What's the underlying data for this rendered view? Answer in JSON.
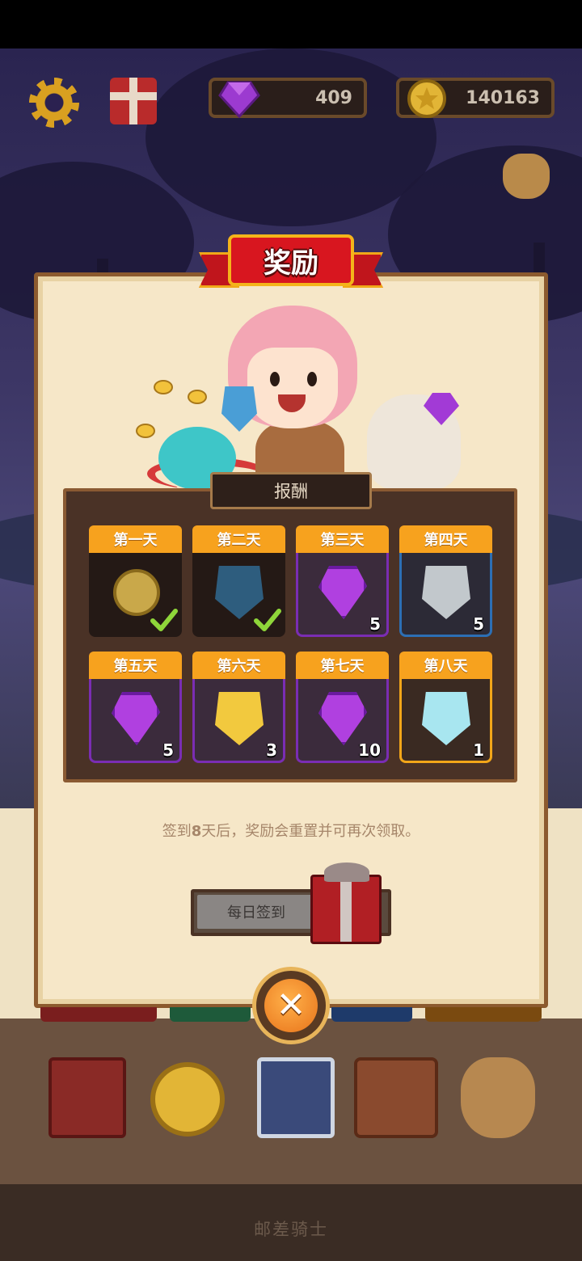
{
  "hud": {
    "gems": "409",
    "coins": "140163",
    "icons": [
      "settings-gear-icon",
      "gift-icon",
      "gem-icon",
      "coin-icon",
      "loot-bag-icon"
    ]
  },
  "dialog": {
    "title": "奖励",
    "board_title": "报酬",
    "rewards": [
      {
        "day": "第一天",
        "item": "coin",
        "quantity": "",
        "claimed": true
      },
      {
        "day": "第二天",
        "item": "dark-blue-shield",
        "quantity": "",
        "claimed": true
      },
      {
        "day": "第三天",
        "item": "purple-gem",
        "quantity": "5",
        "claimed": false
      },
      {
        "day": "第四天",
        "item": "silver-shield",
        "quantity": "5",
        "claimed": false
      },
      {
        "day": "第五天",
        "item": "purple-gem",
        "quantity": "5",
        "claimed": false
      },
      {
        "day": "第六天",
        "item": "gold-shield",
        "quantity": "3",
        "claimed": false
      },
      {
        "day": "第七天",
        "item": "purple-gem",
        "quantity": "10",
        "claimed": false
      },
      {
        "day": "第八天",
        "item": "ice-shield",
        "quantity": "1",
        "claimed": false
      }
    ],
    "info_prefix": "签到",
    "info_number": "8",
    "info_suffix": "天后，奖励会重置并可再次领取。",
    "checkin_label": "每日签到",
    "close_symbol": "✕"
  },
  "footer": {
    "title": "邮差骑士"
  },
  "colors": {
    "day_tab": "#f7a21e",
    "banner_red": "#d8161f",
    "panel": "#f6e7c8",
    "board": "#4a3226",
    "purple_border": "#7a2db3",
    "gold_border": "#f2a619",
    "blue_border": "#2c6fb5"
  }
}
